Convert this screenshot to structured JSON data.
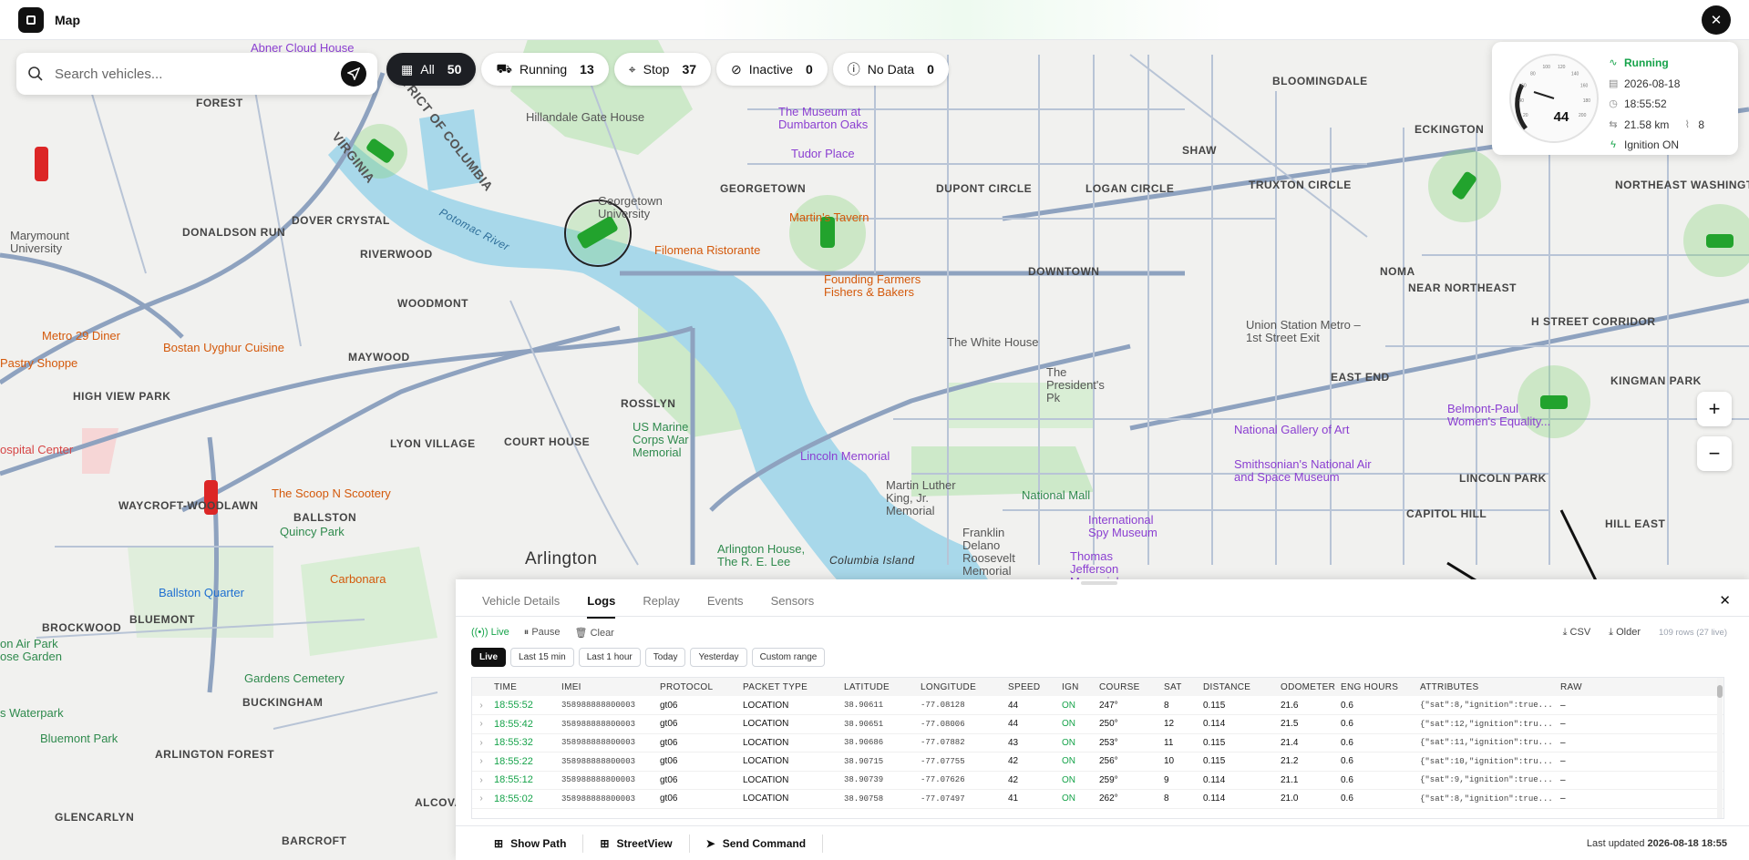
{
  "app": {
    "title": "Map"
  },
  "search": {
    "placeholder": "Search vehicles..."
  },
  "filters": [
    {
      "label": "All",
      "count": "50"
    },
    {
      "label": "Running",
      "count": "13"
    },
    {
      "label": "Stop",
      "count": "37"
    },
    {
      "label": "Inactive",
      "count": "0"
    },
    {
      "label": "No Data",
      "count": "0"
    }
  ],
  "vehicle_card": {
    "speed": "44",
    "status": "Running",
    "date": "2026-08-18",
    "time": "18:55:52",
    "distance": "21.58 km",
    "satellites": "8",
    "ignition": "Ignition ON",
    "gauge_ticks": [
      "20",
      "40",
      "60",
      "80",
      "100",
      "120",
      "140",
      "160",
      "180",
      "200"
    ]
  },
  "map_labels": {
    "forest": "FOREST",
    "donaldson_run": "DONALDSON RUN",
    "dover_crystal": "DOVER CRYSTAL",
    "riverwood": "RIVERWOOD",
    "woodmont": "WOODMONT",
    "maywood": "MAYWOOD",
    "high_view_park": "HIGH VIEW PARK",
    "lyon_village": "LYON VILLAGE",
    "court_house": "COURT HOUSE",
    "rosslyn": "ROSSLYN",
    "waycroft": "WAYCROFT-WOODLAWN",
    "ballston": "BALLSTON",
    "bluemont": "BLUEMONT",
    "brockwood": "BROCKWOOD",
    "buckingham": "BUCKINGHAM",
    "arlington_forest": "ARLINGTON FOREST",
    "glencarlyn": "GLENCARLYN",
    "alcova": "ALCOVA HEIGHTS",
    "barcroft": "BARCROFT",
    "arlington": "Arlington",
    "georgetown": "GEORGETOWN",
    "dupont": "DUPONT CIRCLE",
    "logan": "LOGAN CIRCLE",
    "shaw": "SHAW",
    "truxton": "TRUXTON CIRCLE",
    "bloomingdale": "BLOOMINGDALE",
    "eckington": "ECKINGTON",
    "downtown": "DOWNTOWN",
    "noma": "NOMA",
    "near_ne": "NEAR NORTHEAST",
    "h_street": "H STREET CORRIDOR",
    "kingman": "KINGMAN PARK",
    "ne_washington": "NORTHEAST WASHINGTON",
    "east_end": "EAST END",
    "lincoln_park": "LINCOLN PARK",
    "capitol_hill": "CAPITOL HILL",
    "hill_east": "HILL EAST",
    "virginia": "VIRGINIA",
    "district_columbia": "DISTRICT OF COLUMBIA",
    "potomac_river": "Potomac River",
    "columbia_island": "Columbia Island"
  },
  "pois": {
    "abner": "Abner Cloud House",
    "hillandale": "Hillandale Gate House",
    "museum_oaks": "The Museum at Dumbarton Oaks",
    "tudor": "Tudor Place",
    "georgetown_univ": "Georgetown University",
    "martins": "Martin's Tavern",
    "filomena": "Filomena Ristorante",
    "founding": "Founding Farmers Fishers & Bakers",
    "white_house": "The White House",
    "presidents_pk": "The President's Pk",
    "union_station": "Union Station Metro – 1st Street Exit",
    "national_gallery": "National Gallery of Art",
    "smithsonian": "Smithsonian's National Air and Space Museum",
    "belmont": "Belmont-Paul Women's Equality...",
    "national_mall": "National Mall",
    "spy_museum": "International Spy Museum",
    "mlk": "Martin Luther King, Jr. Memorial",
    "lincoln": "Lincoln Memorial",
    "fdr": "Franklin Delano Roosevelt Memorial",
    "jefferson": "Thomas Jefferson Memorial",
    "marine": "US Marine Corps War Memorial",
    "arlington_house": "Arlington House, The R. E. Lee",
    "metro29": "Metro 29 Diner",
    "pastry": "Pastry Shoppe",
    "bostan": "Bostan Uyghur Cuisine",
    "marymount": "Marymount University",
    "hospital": "ospital Center",
    "scoop": "The Scoop N Scootery",
    "quincy": "Quincy Park",
    "carbonara": "Carbonara",
    "ballston_quarter": "Ballston Quarter",
    "arlington_hall": "on Air Park",
    "rose_garden": "ose Garden",
    "gardens_cemetery": "Gardens Cemetery",
    "waterpark": "s Waterpark",
    "bluemont_park": "Bluemont Park"
  },
  "panel": {
    "tabs": [
      "Vehicle Details",
      "Logs",
      "Replay",
      "Events",
      "Sensors"
    ],
    "active_tab": "Logs",
    "controls": {
      "live": "Live",
      "pause": "Pause",
      "clear": "Clear",
      "csv": "CSV",
      "older": "Older",
      "rows_info": "109 rows (27 live)"
    },
    "ranges": [
      "Live",
      "Last 15 min",
      "Last 1 hour",
      "Today",
      "Yesterday",
      "Custom range"
    ],
    "columns": [
      "TIME",
      "IMEI",
      "PROTOCOL",
      "PACKET TYPE",
      "LATITUDE",
      "LONGITUDE",
      "SPEED",
      "IGN",
      "COURSE",
      "SAT",
      "DISTANCE",
      "ODOMETER",
      "ENG HOURS",
      "ATTRIBUTES",
      "RAW"
    ],
    "rows": [
      [
        "18:55:52",
        "358988888800003",
        "gt06",
        "LOCATION",
        "38.90611",
        "-77.08128",
        "44",
        "ON",
        "247°",
        "8",
        "0.115",
        "21.6",
        "0.6",
        "{\"sat\":8,\"ignition\":true...",
        "–"
      ],
      [
        "18:55:42",
        "358988888800003",
        "gt06",
        "LOCATION",
        "38.90651",
        "-77.08006",
        "44",
        "ON",
        "250°",
        "12",
        "0.114",
        "21.5",
        "0.6",
        "{\"sat\":12,\"ignition\":tru...",
        "–"
      ],
      [
        "18:55:32",
        "358988888800003",
        "gt06",
        "LOCATION",
        "38.90686",
        "-77.07882",
        "43",
        "ON",
        "253°",
        "11",
        "0.115",
        "21.4",
        "0.6",
        "{\"sat\":11,\"ignition\":tru...",
        "–"
      ],
      [
        "18:55:22",
        "358988888800003",
        "gt06",
        "LOCATION",
        "38.90715",
        "-77.07755",
        "42",
        "ON",
        "256°",
        "10",
        "0.115",
        "21.2",
        "0.6",
        "{\"sat\":10,\"ignition\":tru...",
        "–"
      ],
      [
        "18:55:12",
        "358988888800003",
        "gt06",
        "LOCATION",
        "38.90739",
        "-77.07626",
        "42",
        "ON",
        "259°",
        "9",
        "0.114",
        "21.1",
        "0.6",
        "{\"sat\":9,\"ignition\":true...",
        "–"
      ],
      [
        "18:55:02",
        "358988888800003",
        "gt06",
        "LOCATION",
        "38.90758",
        "-77.07497",
        "41",
        "ON",
        "262°",
        "8",
        "0.114",
        "21.0",
        "0.6",
        "{\"sat\":8,\"ignition\":true...",
        "–"
      ]
    ],
    "footer": {
      "show_path": "Show Path",
      "streetview": "StreetView",
      "send_command": "Send Command",
      "last_updated_label": "Last updated",
      "last_updated_value": "2026-08-18 18:55"
    }
  },
  "colors": {
    "accent_green": "#16a34a",
    "vehicle_red": "#dc2626",
    "water": "#a8d8ea",
    "park": "#cde9c9"
  }
}
